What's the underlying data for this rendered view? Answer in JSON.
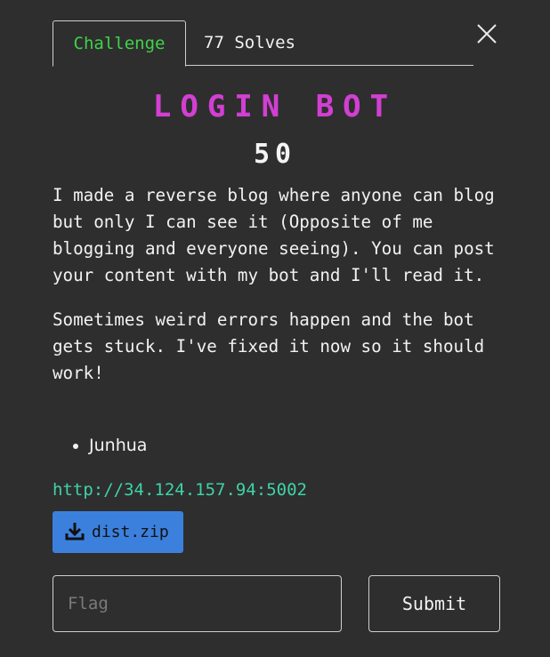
{
  "tabs": {
    "challenge_label": "Challenge",
    "solves_label": "77 Solves"
  },
  "challenge": {
    "name": "LOGIN BOT",
    "points": "50",
    "description": [
      "I made a reverse blog where anyone can blog but only I can see it (Opposite of me blogging and everyone seeing). You can post your content with my bot and I'll read it.",
      "Sometimes weird errors happen and the bot gets stuck. I've fixed it now so it should work!"
    ],
    "authors": [
      "Junhua"
    ],
    "link": "http://34.124.157.94:5002",
    "file_label": "dist.zip"
  },
  "form": {
    "flag_placeholder": "Flag",
    "flag_value": "",
    "submit_label": "Submit"
  },
  "colors": {
    "background": "#2e2e2e",
    "title": "#d23fd2",
    "tab_active": "#3fd24a",
    "link": "#3fd2a8",
    "file_button": "#3c80dd"
  },
  "icons": {
    "close": "close-icon",
    "download": "download-icon"
  }
}
